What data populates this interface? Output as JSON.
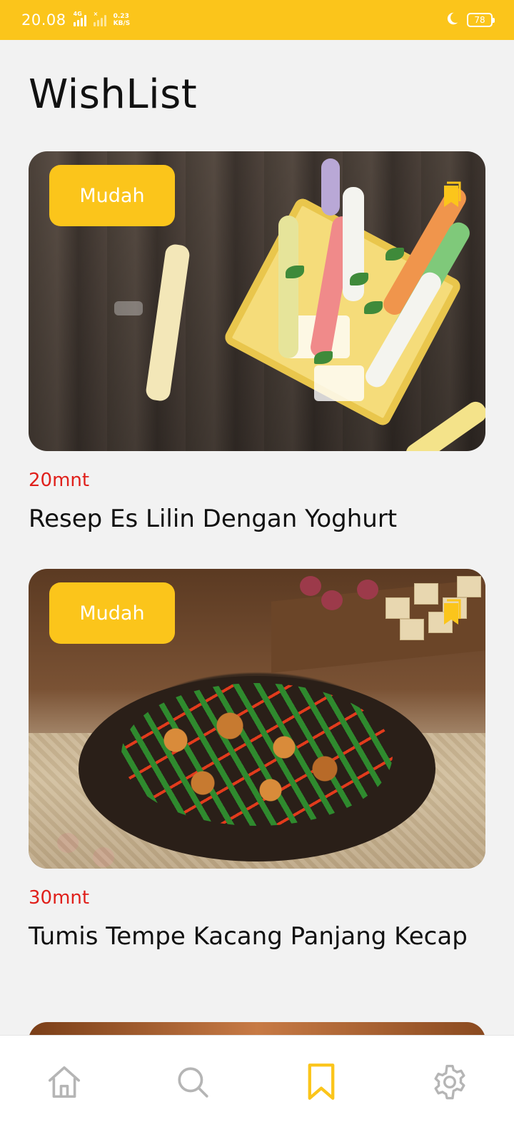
{
  "status_bar": {
    "time": "20.08",
    "network_1": "4G",
    "network_2": "×",
    "speed_value": "0.23",
    "speed_unit": "KB/S",
    "battery": "78",
    "bg_color": "#fbc51b"
  },
  "page": {
    "title": "WishList"
  },
  "recipes": [
    {
      "difficulty": "Mudah",
      "time": "20mnt",
      "title": "Resep Es Lilin Dengan Yoghurt",
      "image": "popsicle-photo",
      "bookmarked": true
    },
    {
      "difficulty": "Mudah",
      "time": "30mnt",
      "title": "Tumis Tempe Kacang Panjang Kecap",
      "image": "stir-fry-photo",
      "bookmarked": true
    }
  ],
  "bottom_nav": {
    "items": [
      {
        "name": "home",
        "icon": "home-icon",
        "active": false
      },
      {
        "name": "search",
        "icon": "search-icon",
        "active": false
      },
      {
        "name": "wishlist",
        "icon": "bookmark-icon",
        "active": true
      },
      {
        "name": "settings",
        "icon": "gear-icon",
        "active": false
      }
    ],
    "active_color": "#fbc51b",
    "inactive_color": "#b5b5b5"
  },
  "colors": {
    "accent": "#fbc51b",
    "time_red": "#e0201b",
    "background": "#f2f2f2"
  }
}
